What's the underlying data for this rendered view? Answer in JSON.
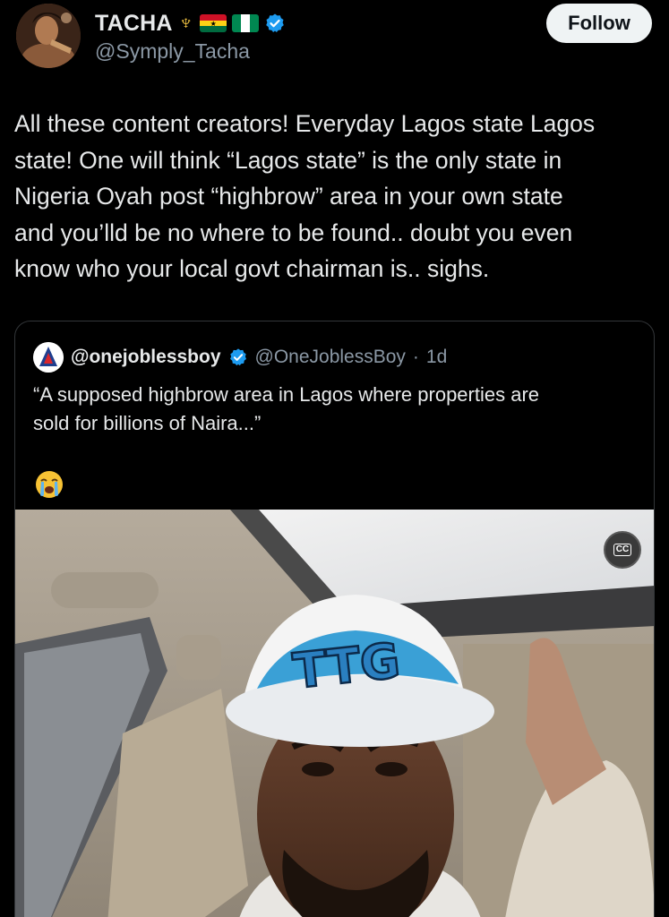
{
  "author": {
    "display_name": "TACHA",
    "handle": "@Symply_Tacha",
    "trident_symbol": "♆",
    "flags": [
      "ghana-flag",
      "nigeria-flag"
    ],
    "verified_icon": "verified-badge-icon"
  },
  "follow_button": {
    "label": "Follow"
  },
  "tweet": {
    "lines": [
      "All these content creators! Everyday Lagos state Lagos",
      "state! One will think “Lagos state” is the only state in",
      "Nigeria Oyah post “highbrow” area in your own state",
      "and you’lld be no where to be found.. doubt you even",
      "know who your local govt chairman is.. sighs."
    ]
  },
  "quoted": {
    "display_name": "@onejoblessboy",
    "handle": "@OneJoblessBoy",
    "separator": "·",
    "time": "1d",
    "lines": [
      "“A supposed highbrow area in Lagos where properties are",
      "sold for billions of Naira...”"
    ],
    "emoji": "😭",
    "cap_text": "TTG",
    "cc_label": "CC"
  },
  "colors": {
    "background": "#000000",
    "text": "#e7e9ea",
    "secondary": "#8b98a5",
    "verified": "#1d9bf0",
    "follow_bg": "#eff3f4"
  }
}
